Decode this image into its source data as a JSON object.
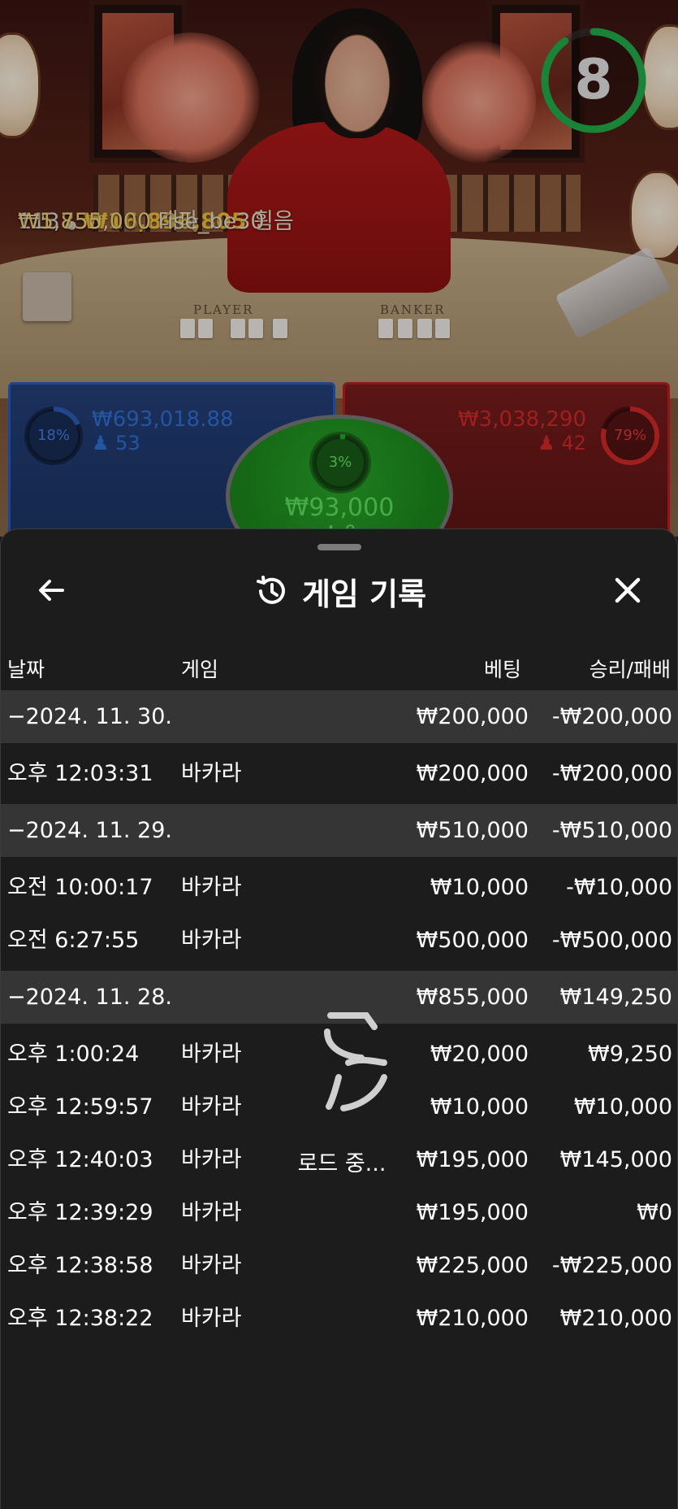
{
  "stream": {
    "timer": "8",
    "timer_fraction": 0.9,
    "table_labels": {
      "player": "PLAYER",
      "banker": "BANKER"
    },
    "winners": [
      {
        "count": "113",
        "amount": "₩16,896,805",
        "name": "휨음"
      },
      {
        "amount": "₩5,850,000",
        "name": "대파"
      },
      {
        "amount": "₩1,755,000",
        "name": "rise_be30"
      }
    ]
  },
  "bets": {
    "player": {
      "percent": "18%",
      "percent_value": 0.18,
      "amount": "₩693,018.88",
      "users": "53",
      "color": "#2c5fb8"
    },
    "tie": {
      "percent": "3%",
      "percent_value": 0.03,
      "amount": "₩93,000",
      "users": "8",
      "color": "#2aa82a"
    },
    "banker": {
      "percent": "79%",
      "percent_value": 0.79,
      "amount": "₩3,038,290",
      "users": "42",
      "color": "#d42a2a"
    }
  },
  "sheet": {
    "title": "게임 기록",
    "back_icon": "arrow-left-icon",
    "history_icon": "history-icon",
    "close_icon": "close-icon",
    "columns": {
      "date": "날짜",
      "game": "게임",
      "bet": "베팅",
      "result": "승리/패배"
    },
    "loading_text": "로드 중...",
    "rows": [
      {
        "type": "date",
        "date": "−2024. 11. 30.",
        "bet": "₩200,000",
        "result": "-₩200,000"
      },
      {
        "type": "entry",
        "time": "오후 12:03:31",
        "game": "바카라",
        "bet": "₩200,000",
        "result": "-₩200,000"
      },
      {
        "type": "date",
        "date": "−2024. 11. 29.",
        "bet": "₩510,000",
        "result": "-₩510,000"
      },
      {
        "type": "entry",
        "time": "오전 10:00:17",
        "game": "바카라",
        "bet": "₩10,000",
        "result": "-₩10,000"
      },
      {
        "type": "entry",
        "time": "오전 6:27:55",
        "game": "바카라",
        "bet": "₩500,000",
        "result": "-₩500,000"
      },
      {
        "type": "date",
        "date": "−2024. 11. 28.",
        "bet": "₩855,000",
        "result": "₩149,250"
      },
      {
        "type": "entry",
        "time": "오후 1:00:24",
        "game": "바카라",
        "bet": "₩20,000",
        "result": "₩9,250"
      },
      {
        "type": "entry",
        "time": "오후 12:59:57",
        "game": "바카라",
        "bet": "₩10,000",
        "result": "₩10,000"
      },
      {
        "type": "entry",
        "time": "오후 12:40:03",
        "game": "바카라",
        "bet": "₩195,000",
        "result": "₩145,000"
      },
      {
        "type": "entry",
        "time": "오후 12:39:29",
        "game": "바카라",
        "bet": "₩195,000",
        "result": "₩0"
      },
      {
        "type": "entry",
        "time": "오후 12:38:58",
        "game": "바카라",
        "bet": "₩225,000",
        "result": "-₩225,000"
      },
      {
        "type": "entry",
        "time": "오후 12:38:22",
        "game": "바카라",
        "bet": "₩210,000",
        "result": "₩210,000"
      }
    ]
  }
}
